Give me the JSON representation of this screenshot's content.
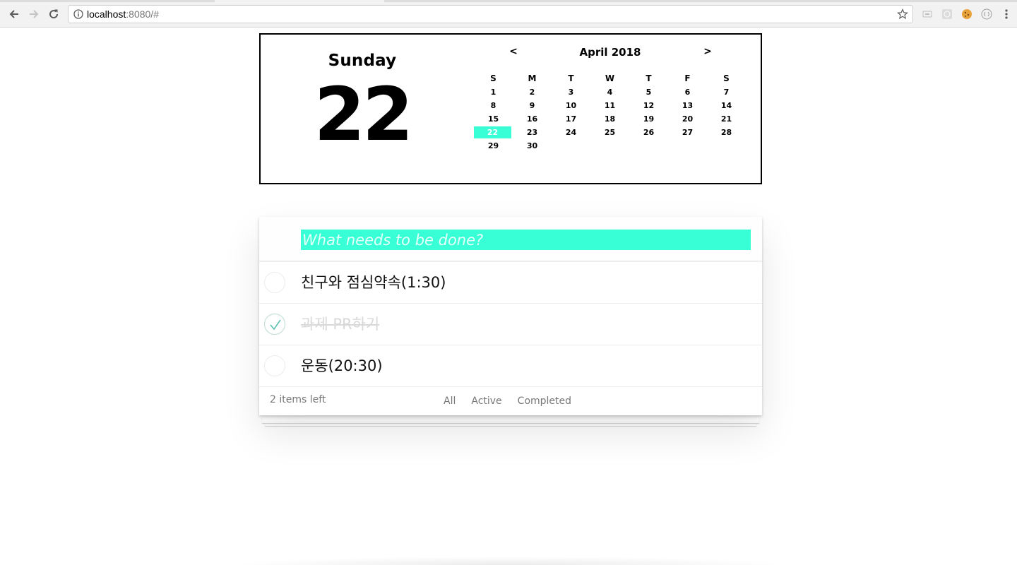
{
  "browser": {
    "url_host": "localhost",
    "url_rest": ":8080/#",
    "icons": [
      "back-icon",
      "forward-icon",
      "reload-icon",
      "info-icon",
      "star-icon"
    ]
  },
  "calendar": {
    "day_name": "Sunday",
    "day_number": "22",
    "prev_label": "<",
    "next_label": ">",
    "month_title": "April 2018",
    "weekdays": [
      "S",
      "M",
      "T",
      "W",
      "T",
      "F",
      "S"
    ],
    "first_weekday_index": 0,
    "days_in_month": 30,
    "selected_day": 22,
    "accent_color": "#39ffd6"
  },
  "todo": {
    "placeholder": "What needs to be done?",
    "items": [
      {
        "title": "친구와 점심약속(1:30)",
        "completed": false
      },
      {
        "title": "과제 PR하기",
        "completed": true
      },
      {
        "title": "운동(20:30)",
        "completed": false
      }
    ],
    "count_label": "2 items left",
    "filters": [
      "All",
      "Active",
      "Completed"
    ]
  }
}
